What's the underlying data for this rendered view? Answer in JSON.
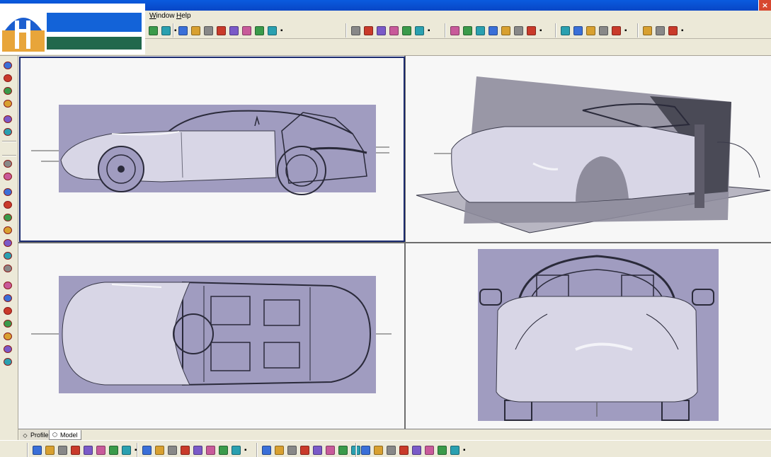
{
  "window": {
    "close_glyph": "×"
  },
  "menu": [
    {
      "label": "Window",
      "accel": "W",
      "rest": "indow"
    },
    {
      "label": "Help",
      "accel": "H",
      "rest": "elp"
    }
  ],
  "toolbars": {
    "more_glyph": "▪",
    "top_groups": [
      [
        "draw-frame-icon",
        "grid-tool-icon"
      ],
      [
        "material-icon",
        "render-icon",
        "shading-icon",
        "light-icon",
        "rewind-icon",
        "fast-back-icon",
        "play-icon",
        "options-icon"
      ],
      [
        "photo-studio-icon",
        "edit-sheet-icon",
        "capture-icon",
        "gallery-icon",
        "camera-icon",
        "preview-icon"
      ],
      [
        "delete-x-icon",
        "cut-x-icon",
        "copy-icon",
        "paste-icon",
        "link-icon",
        "snap-icon",
        "measure-icon"
      ],
      [
        "dimension-icon",
        "tools-icon",
        "mesh-icon",
        "catalog-icon",
        "folder-options-icon"
      ],
      [
        "sketch-icon",
        "part-box-icon",
        "notes-icon"
      ]
    ],
    "bottom_groups": [
      [
        "plane-icon",
        "view-front-icon",
        "view-back-icon",
        "view-iso-icon",
        "view-right-icon",
        "view-left-icon",
        "view-top-icon",
        "sphere-icon"
      ],
      [
        "normal-view-icon",
        "fit-all-icon",
        "zoom-icon",
        "pan-icon",
        "rotate-icon",
        "multi-view-icon",
        "shading-mode-icon",
        "cube-icon"
      ],
      [
        "solid-shade-icon",
        "edge-shade-icon",
        "wire-icon",
        "render-shade-icon",
        "material-shade-icon",
        "texture-icon",
        "section-icon",
        "extract-icon"
      ],
      [
        "box-primitive-icon",
        "cylinder-icon",
        "sweep-icon",
        "loft-icon",
        "cone-icon",
        "torus-icon",
        "boolean-icon",
        "lock-icon"
      ]
    ]
  },
  "colors": {
    "accent": "#1363d8",
    "logo_green": "#21684c",
    "blueprint": "#a09cc0",
    "car_body": "#d8d6e6"
  },
  "viewports": [
    {
      "id": "side",
      "view": "side-elevation"
    },
    {
      "id": "perspective",
      "view": "isometric-3d"
    },
    {
      "id": "top",
      "view": "plan-view"
    },
    {
      "id": "front",
      "view": "front-elevation"
    }
  ],
  "tabs": [
    {
      "label": "Profile",
      "icon": "profile-icon",
      "active": false
    },
    {
      "label": "Model",
      "icon": "model-cube-icon",
      "active": true
    }
  ]
}
